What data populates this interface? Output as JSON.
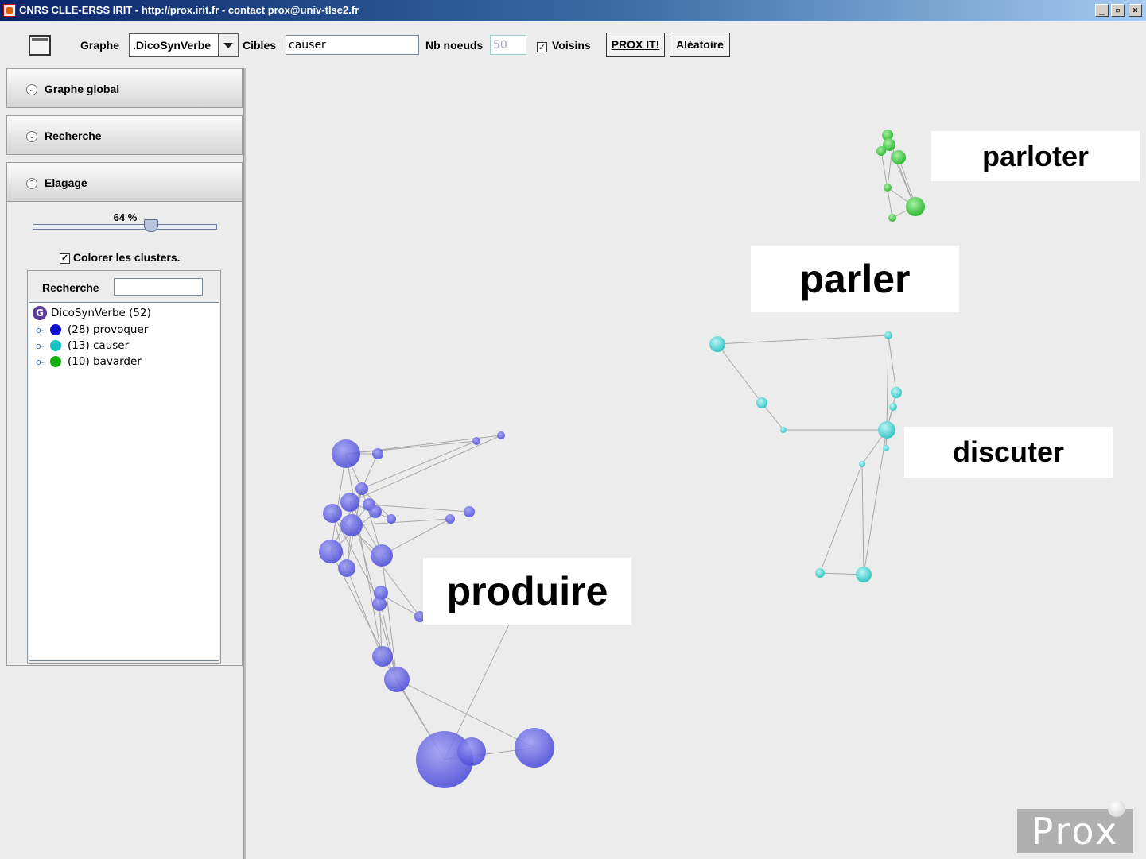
{
  "window": {
    "title": "CNRS CLLE-ERSS IRIT - http://prox.irit.fr - contact prox@univ-tlse2.fr",
    "minimize": "_",
    "maximize": "▫",
    "close": "×"
  },
  "toolbar": {
    "graphe_label": "Graphe",
    "graphe_value": ".DicoSynVerbe",
    "cibles_label": "Cibles",
    "cibles_value": "causer",
    "nbnoeuds_label": "Nb noeuds",
    "nbnoeuds_value": "50",
    "voisins_label": "Voisins",
    "voisins_checked": true,
    "prox_button": "PROX IT!",
    "random_button": "Aléatoire"
  },
  "sidebar": {
    "sections": [
      {
        "label": "Graphe global",
        "expanded": false
      },
      {
        "label": "Recherche",
        "expanded": false
      },
      {
        "label": "Elagage",
        "expanded": true
      }
    ],
    "elagage": {
      "slider_percent": "64 %",
      "slider_value": 64,
      "colorer_label": "Colorer les clusters.",
      "colorer_checked": true,
      "search_label": "Recherche",
      "search_value": "",
      "tree_root": "DicoSynVerbe (52)",
      "clusters": [
        {
          "label": "(28) provoquer",
          "color": "#1010d0"
        },
        {
          "label": "(13) causer",
          "color": "#19c2c2"
        },
        {
          "label": "(10) bavarder",
          "color": "#10b010"
        }
      ]
    }
  },
  "graph": {
    "labels": [
      "parloter",
      "parler",
      "discuter",
      "produire"
    ],
    "cluster_colors": {
      "provoquer": "#5a5ae6",
      "causer": "#5ad8d8",
      "bavarder": "#4ed04e"
    },
    "logo_text": "Prox"
  }
}
